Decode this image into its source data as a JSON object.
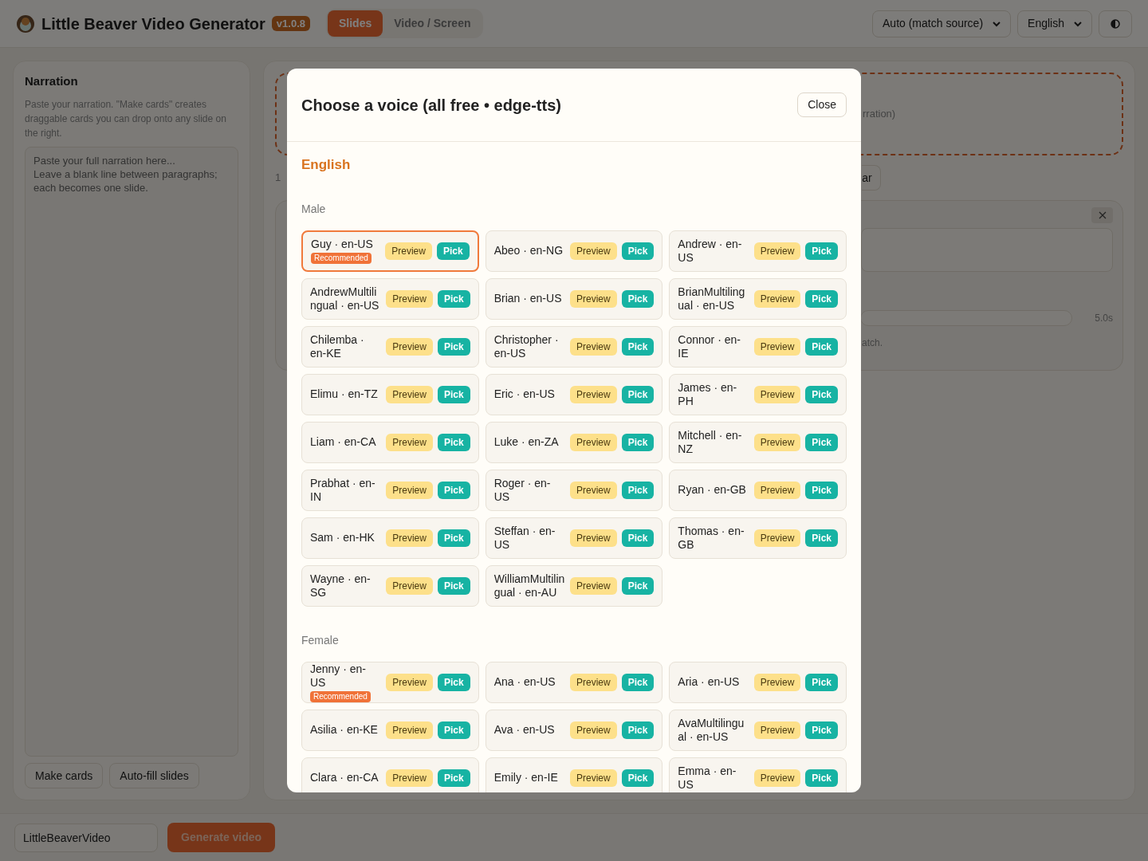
{
  "header": {
    "title": "Little Beaver Video Generator",
    "version": "v1.0.8",
    "tabs": [
      {
        "label": "Slides",
        "selected": true
      },
      {
        "label": "Video / Screen",
        "selected": false
      }
    ],
    "selects": [
      {
        "value": "Auto (match source)"
      },
      {
        "value": "English"
      }
    ]
  },
  "narration": {
    "title": "Narration",
    "description": "Paste your narration. \"Make cards\" creates draggable cards you can drop onto any slide on the right.",
    "placeholder": "Paste your full narration here...\nLeave a blank line between paragraphs; each becomes one slide.",
    "buttons": [
      "Make cards",
      "Auto-fill slides"
    ]
  },
  "slides_panel": {
    "drop_zone_text": "rration)",
    "slide_count": "1",
    "clear_button": "ar",
    "duration": "5.0s",
    "hint": "atch."
  },
  "footer": {
    "filename": "LittleBeaverVideo",
    "generate_button": "Generate video"
  },
  "voice_dialog": {
    "title": "Choose a voice (all free • edge-tts)",
    "close": "Close",
    "language": "English",
    "groups": [
      {
        "label": "Male",
        "voices": [
          {
            "name": "Guy · en-US",
            "recommended": true,
            "badge": "Recommended",
            "selected": true,
            "preview": "Preview",
            "pick": "Pick"
          },
          {
            "name": "Abeo · en-NG",
            "recommended": false,
            "selected": false,
            "preview": "Preview",
            "pick": "Pick"
          },
          {
            "name": "Andrew · en-US",
            "recommended": false,
            "selected": false,
            "preview": "Preview",
            "pick": "Pick"
          },
          {
            "name": "AndrewMultilingual · en-US",
            "recommended": false,
            "selected": false,
            "preview": "Preview",
            "pick": "Pick"
          },
          {
            "name": "Brian · en-US",
            "recommended": false,
            "selected": false,
            "preview": "Preview",
            "pick": "Pick"
          },
          {
            "name": "BrianMultilingual · en-US",
            "recommended": false,
            "selected": false,
            "preview": "Preview",
            "pick": "Pick"
          },
          {
            "name": "Chilemba · en-KE",
            "recommended": false,
            "selected": false,
            "preview": "Preview",
            "pick": "Pick"
          },
          {
            "name": "Christopher · en-US",
            "recommended": false,
            "selected": false,
            "preview": "Preview",
            "pick": "Pick"
          },
          {
            "name": "Connor · en-IE",
            "recommended": false,
            "selected": false,
            "preview": "Preview",
            "pick": "Pick"
          },
          {
            "name": "Elimu · en-TZ",
            "recommended": false,
            "selected": false,
            "preview": "Preview",
            "pick": "Pick"
          },
          {
            "name": "Eric · en-US",
            "recommended": false,
            "selected": false,
            "preview": "Preview",
            "pick": "Pick"
          },
          {
            "name": "James · en-PH",
            "recommended": false,
            "selected": false,
            "preview": "Preview",
            "pick": "Pick"
          },
          {
            "name": "Liam · en-CA",
            "recommended": false,
            "selected": false,
            "preview": "Preview",
            "pick": "Pick"
          },
          {
            "name": "Luke · en-ZA",
            "recommended": false,
            "selected": false,
            "preview": "Preview",
            "pick": "Pick"
          },
          {
            "name": "Mitchell · en-NZ",
            "recommended": false,
            "selected": false,
            "preview": "Preview",
            "pick": "Pick"
          },
          {
            "name": "Prabhat · en-IN",
            "recommended": false,
            "selected": false,
            "preview": "Preview",
            "pick": "Pick"
          },
          {
            "name": "Roger · en-US",
            "recommended": false,
            "selected": false,
            "preview": "Preview",
            "pick": "Pick"
          },
          {
            "name": "Ryan · en-GB",
            "recommended": false,
            "selected": false,
            "preview": "Preview",
            "pick": "Pick"
          },
          {
            "name": "Sam · en-HK",
            "recommended": false,
            "selected": false,
            "preview": "Preview",
            "pick": "Pick"
          },
          {
            "name": "Steffan · en-US",
            "recommended": false,
            "selected": false,
            "preview": "Preview",
            "pick": "Pick"
          },
          {
            "name": "Thomas · en-GB",
            "recommended": false,
            "selected": false,
            "preview": "Preview",
            "pick": "Pick"
          },
          {
            "name": "Wayne · en-SG",
            "recommended": false,
            "selected": false,
            "preview": "Preview",
            "pick": "Pick"
          },
          {
            "name": "WilliamMultilingual · en-AU",
            "recommended": false,
            "selected": false,
            "preview": "Preview",
            "pick": "Pick"
          }
        ]
      },
      {
        "label": "Female",
        "voices": [
          {
            "name": "Jenny · en-US",
            "recommended": true,
            "badge": "Recommended",
            "selected": false,
            "preview": "Preview",
            "pick": "Pick"
          },
          {
            "name": "Ana · en-US",
            "recommended": false,
            "selected": false,
            "preview": "Preview",
            "pick": "Pick"
          },
          {
            "name": "Aria · en-US",
            "recommended": false,
            "selected": false,
            "preview": "Preview",
            "pick": "Pick"
          },
          {
            "name": "Asilia · en-KE",
            "recommended": false,
            "selected": false,
            "preview": "Preview",
            "pick": "Pick"
          },
          {
            "name": "Ava · en-US",
            "recommended": false,
            "selected": false,
            "preview": "Preview",
            "pick": "Pick"
          },
          {
            "name": "AvaMultilingual · en-US",
            "recommended": false,
            "selected": false,
            "preview": "Preview",
            "pick": "Pick"
          },
          {
            "name": "Clara · en-CA",
            "recommended": false,
            "selected": false,
            "preview": "Preview",
            "pick": "Pick"
          },
          {
            "name": "Emily · en-IE",
            "recommended": false,
            "selected": false,
            "preview": "Preview",
            "pick": "Pick"
          },
          {
            "name": "Emma · en-US",
            "recommended": false,
            "selected": false,
            "preview": "Preview",
            "pick": "Pick"
          }
        ]
      }
    ]
  }
}
